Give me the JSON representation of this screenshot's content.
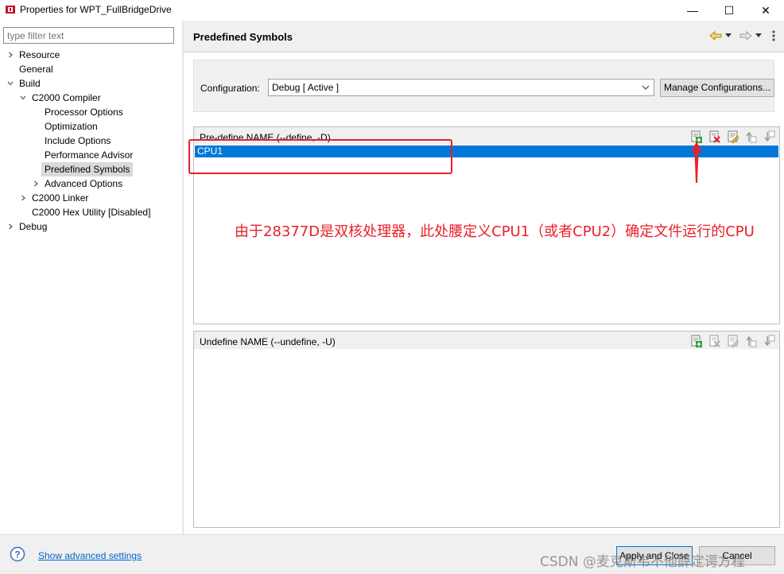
{
  "window": {
    "title": "Properties for WPT_FullBridgeDrive",
    "minimize": "—",
    "maximize": "☐",
    "close": "✕"
  },
  "filter": {
    "placeholder": "type filter text"
  },
  "tree": [
    {
      "label": "Resource",
      "chevron": "right",
      "indent": 0
    },
    {
      "label": "General",
      "chevron": "none",
      "indent": 0
    },
    {
      "label": "Build",
      "chevron": "down",
      "indent": 0
    },
    {
      "label": "C2000 Compiler",
      "chevron": "down",
      "indent": 1
    },
    {
      "label": "Processor Options",
      "chevron": "none",
      "indent": 2
    },
    {
      "label": "Optimization",
      "chevron": "none",
      "indent": 2
    },
    {
      "label": "Include Options",
      "chevron": "none",
      "indent": 2
    },
    {
      "label": "Performance Advisor",
      "chevron": "none",
      "indent": 2
    },
    {
      "label": "Predefined Symbols",
      "chevron": "none",
      "indent": 2,
      "selected": true
    },
    {
      "label": "Advanced Options",
      "chevron": "right",
      "indent": 2
    },
    {
      "label": "C2000 Linker",
      "chevron": "right",
      "indent": 1
    },
    {
      "label": "C2000 Hex Utility  [Disabled]",
      "chevron": "none",
      "indent": 1
    },
    {
      "label": "Debug",
      "chevron": "right",
      "indent": 0
    }
  ],
  "page": {
    "title": "Predefined Symbols",
    "config_label": "Configuration:",
    "config_value": "Debug  [ Active ]",
    "manage_button": "Manage Configurations..."
  },
  "define_list": {
    "title": "Pre-define NAME (--define, -D)",
    "items": [
      "CPU1"
    ]
  },
  "undefine_list": {
    "title": "Undefine NAME (--undefine, -U)",
    "items": []
  },
  "annotation": {
    "text": "由于28377D是双核处理器，此处腰定义CPU1（或者CPU2）确定文件运行的CPU",
    "color": "#e8202a"
  },
  "bottom": {
    "advanced_link": "Show advanced settings",
    "apply_close": "Apply and Close",
    "cancel": "Cancel"
  },
  "watermark": "CSDN @麦克斯韦不他薛定谔方程"
}
